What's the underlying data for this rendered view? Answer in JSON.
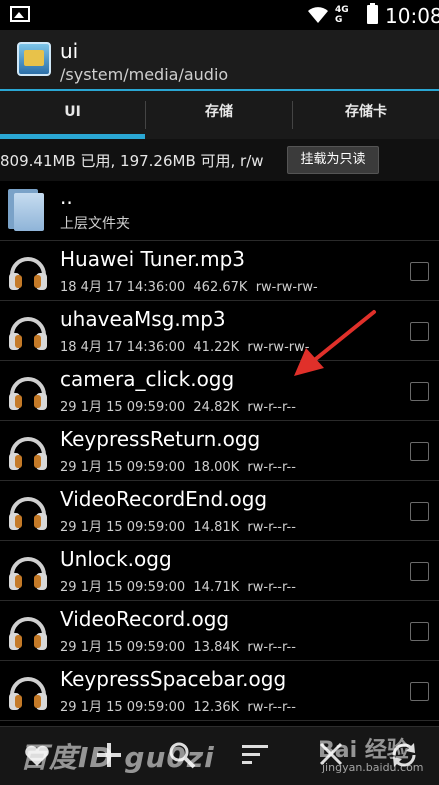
{
  "status": {
    "network": "4G\nG",
    "time": "10:08"
  },
  "appbar": {
    "title": "ui",
    "path": "/system/media/audio"
  },
  "tabs": [
    {
      "label": "UI",
      "selected": true
    },
    {
      "label": "存储",
      "selected": false
    },
    {
      "label": "存储卡",
      "selected": false
    }
  ],
  "storage": {
    "info": "809.41MB 已用, 197.26MB 可用, r/w",
    "button": "挂载为只读"
  },
  "parent": {
    "name": "..",
    "label": "上层文件夹"
  },
  "files": [
    {
      "name": "Huawei Tuner.mp3",
      "date": "18 4月 17 14:36:00",
      "size": "462.67K",
      "perm": "rw-rw-rw-"
    },
    {
      "name": "uhaveaMsg.mp3",
      "date": "18 4月 17 14:36:00",
      "size": "41.22K",
      "perm": "rw-rw-rw-"
    },
    {
      "name": "camera_click.ogg",
      "date": "29 1月 15 09:59:00",
      "size": "24.82K",
      "perm": "rw-r--r--"
    },
    {
      "name": "KeypressReturn.ogg",
      "date": "29 1月 15 09:59:00",
      "size": "18.00K",
      "perm": "rw-r--r--"
    },
    {
      "name": "VideoRecordEnd.ogg",
      "date": "29 1月 15 09:59:00",
      "size": "14.81K",
      "perm": "rw-r--r--"
    },
    {
      "name": "Unlock.ogg",
      "date": "29 1月 15 09:59:00",
      "size": "14.71K",
      "perm": "rw-r--r--"
    },
    {
      "name": "VideoRecord.ogg",
      "date": "29 1月 15 09:59:00",
      "size": "13.84K",
      "perm": "rw-r--r--"
    },
    {
      "name": "KeypressSpacebar.ogg",
      "date": "29 1月 15 09:59:00",
      "size": "12.36K",
      "perm": "rw-r--r--"
    }
  ],
  "watermark": {
    "left": "百度ID gu0zi",
    "right": "Bai 经验",
    "right_url": "jingyan.baidu.com"
  },
  "colors": {
    "accent": "#2aa7d4",
    "arrow": "#e0302a"
  }
}
